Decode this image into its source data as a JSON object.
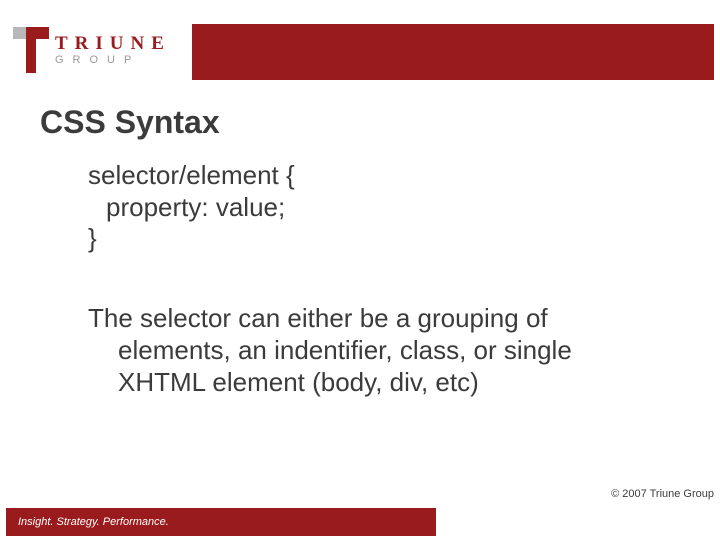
{
  "logo": {
    "brand": "TRIUNE",
    "sub": "GROUP"
  },
  "title": "CSS Syntax",
  "code": {
    "line1": "selector/element {",
    "line2": "property: value;",
    "line3": "}"
  },
  "paragraph": {
    "line1": "The selector can either be a grouping of",
    "line2": "elements, an indentifier, class, or single",
    "line3": "XHTML element (body, div, etc)"
  },
  "copyright": "© 2007 Triune Group",
  "tagline": "Insight. Strategy. Performance."
}
